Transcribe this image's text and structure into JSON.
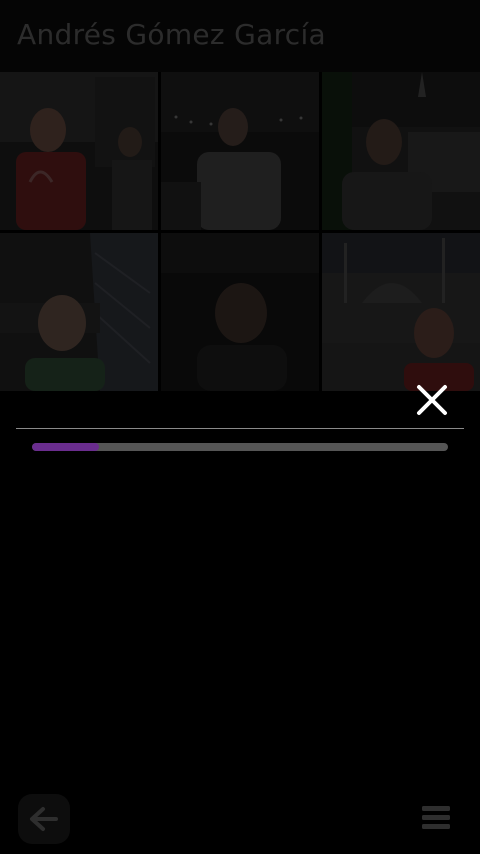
{
  "header": {
    "title": "Andrés Gómez García"
  },
  "gallery": {
    "thumbnails": [
      {
        "icon": "photo-thumbnail"
      },
      {
        "icon": "photo-thumbnail"
      },
      {
        "icon": "photo-thumbnail"
      },
      {
        "icon": "photo-thumbnail"
      },
      {
        "icon": "photo-thumbnail"
      },
      {
        "icon": "photo-thumbnail"
      }
    ]
  },
  "loading": {
    "progress": 0.16,
    "progress_color": "#6a2d8e",
    "close_icon": "close-icon"
  },
  "toolbar": {
    "back_icon": "back-arrow-icon",
    "menu_icon": "menu-icon"
  }
}
